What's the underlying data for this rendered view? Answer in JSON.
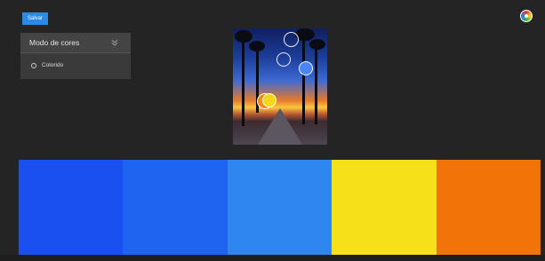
{
  "toolbar": {
    "save_label": "Salvar",
    "color_wheel_icon": "color-wheel-icon"
  },
  "panel": {
    "title": "Modo de cores",
    "chevron_icon": "chevron-double-down-icon",
    "options": [
      {
        "label": "Colorido",
        "selected": false
      }
    ]
  },
  "palette": {
    "colors": [
      "#1a4ff0",
      "#1f64f0",
      "#2f86f0",
      "#f6e01a",
      "#f27408"
    ],
    "picker_circle_fills": [
      "transparent",
      "transparent",
      "#4a86f2",
      "#f5d71a",
      "#f28a14"
    ]
  },
  "colors": {
    "accent": "#2a8ae8",
    "background": "#242424",
    "panel": "#3a3a3a"
  }
}
